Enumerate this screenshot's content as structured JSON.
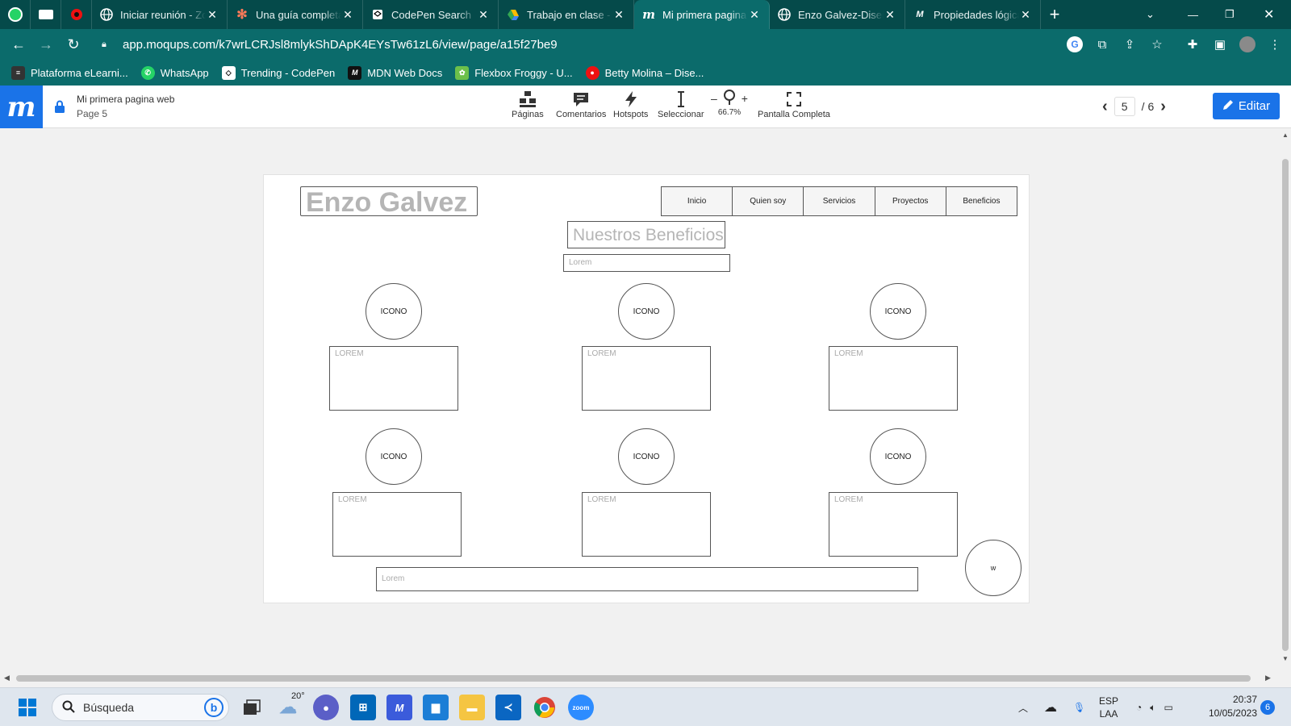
{
  "browser": {
    "pinned_tabs": [
      "whatsapp",
      "elearning",
      "opera"
    ],
    "tabs": [
      {
        "title": "Iniciar reunión - Zoom",
        "icon": "globe-icon"
      },
      {
        "title": "Una guía completa",
        "icon": "asterisk-icon"
      },
      {
        "title": "CodePen Search",
        "icon": "codepen-icon"
      },
      {
        "title": "Trabajo en clase - Google Drive",
        "icon": "drive-icon"
      },
      {
        "title": "Mi primera pagina",
        "icon": "moqups-icon"
      },
      {
        "title": "Enzo Galvez-Diseño",
        "icon": "globe-icon"
      },
      {
        "title": "Propiedades lógicas",
        "icon": "mdn-icon"
      }
    ],
    "new_tab": "+",
    "url": "app.moqups.com/k7wrLCRJsl8mlykShDApK4EYsTw61zL6/view/page/a15f27be9",
    "bookmarks": [
      {
        "label": "Plataforma eLearni...",
        "icon": "elearning-icon"
      },
      {
        "label": "WhatsApp",
        "icon": "whatsapp-icon"
      },
      {
        "label": "Trending - CodePen",
        "icon": "codepen-icon"
      },
      {
        "label": "MDN Web Docs",
        "icon": "mdn-icon"
      },
      {
        "label": "Flexbox Froggy - U...",
        "icon": "frog-icon"
      },
      {
        "label": "Betty Molina – Dise...",
        "icon": "opera-icon"
      }
    ]
  },
  "moqups": {
    "logo": "m",
    "doc_title": "Mi primera pagina web",
    "page_label": "Page 5",
    "tools": [
      {
        "label": "Páginas",
        "icon": "pages-icon"
      },
      {
        "label": "Comentarios",
        "icon": "comments-icon"
      },
      {
        "label": "Hotspots",
        "icon": "bolt-icon"
      },
      {
        "label": "Seleccionar",
        "icon": "text-cursor-icon"
      }
    ],
    "zoom": {
      "minus": "–",
      "plus": "+",
      "value": "66.7%"
    },
    "fullscreen_label": "Pantalla Completa",
    "pager": {
      "current": "5",
      "total": "/ 6"
    },
    "edit_label": "Editar"
  },
  "mockup": {
    "logo_text": "Enzo Galvez",
    "nav": [
      "Inicio",
      "Quien soy",
      "Servicios",
      "Proyectos",
      "Beneficios"
    ],
    "heading": "Nuestros Beneficios:",
    "subtitle_placeholder": "Lorem",
    "icon_label": "ICONO",
    "box_label": "LOREM",
    "footer_placeholder": "Lorem",
    "whatsapp_circle_label": "w"
  },
  "taskbar": {
    "search_placeholder": "Búsqueda",
    "weather_temp": "20°",
    "language": "ESP",
    "layout": "LAA",
    "time": "20:37",
    "date": "10/05/2023",
    "notifications": "6"
  }
}
